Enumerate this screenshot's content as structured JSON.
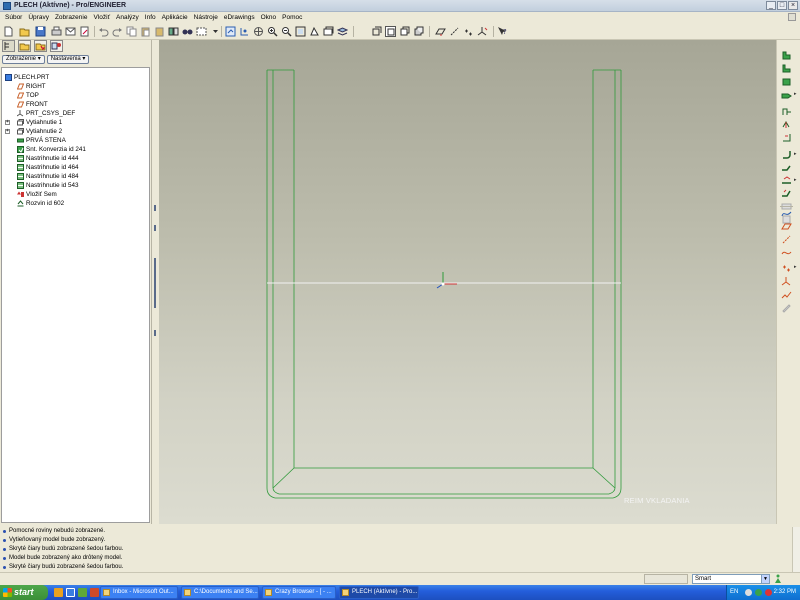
{
  "window": {
    "title": "PLECH (Aktívne) - Pro/ENGINEER",
    "controls": [
      "_",
      "□",
      "×"
    ]
  },
  "menu": [
    "Súbor",
    "Úpravy",
    "Zobrazenie",
    "Vložiť",
    "Analýzy",
    "Info",
    "Aplikácie",
    "Nástroje",
    "eDrawings",
    "Okno",
    "Pomoc"
  ],
  "panel": {
    "dropdowns": [
      "Zobrazenie",
      "Nastavenia"
    ]
  },
  "tree": [
    {
      "label": "PLECH.PRT",
      "icon": "part-icon",
      "indent": 0,
      "expander": ""
    },
    {
      "label": "RIGHT",
      "icon": "datum-plane-icon",
      "indent": 1,
      "expander": ""
    },
    {
      "label": "TOP",
      "icon": "datum-plane-icon",
      "indent": 1,
      "expander": ""
    },
    {
      "label": "FRONT",
      "icon": "datum-plane-icon",
      "indent": 1,
      "expander": ""
    },
    {
      "label": "PRT_CSYS_DEF",
      "icon": "csys-icon",
      "indent": 1,
      "expander": ""
    },
    {
      "label": "Vytiahnutie 1",
      "icon": "extrude-icon",
      "indent": 1,
      "expander": "+"
    },
    {
      "label": "Vytiahnutie 2",
      "icon": "extrude-icon",
      "indent": 1,
      "expander": "+"
    },
    {
      "label": "PRVÁ STENA",
      "icon": "wall-icon",
      "indent": 1,
      "expander": ""
    },
    {
      "label": "Snt. Konverzia id 241",
      "icon": "conversion-icon",
      "indent": 1,
      "expander": ""
    },
    {
      "label": "Nastrihnutie id 444",
      "icon": "rip-icon",
      "indent": 1,
      "expander": ""
    },
    {
      "label": "Nastrihnutie id 464",
      "icon": "rip-icon",
      "indent": 1,
      "expander": ""
    },
    {
      "label": "Nastrihnutie id 484",
      "icon": "rip-icon",
      "indent": 1,
      "expander": ""
    },
    {
      "label": "Nastrihnutie id 543",
      "icon": "rip-icon",
      "indent": 1,
      "expander": ""
    },
    {
      "label": "Vložiť Sem",
      "icon": "insert-here-icon",
      "indent": 1,
      "expander": ""
    },
    {
      "label": "Rozvin id 602",
      "icon": "unbend-icon",
      "indent": 1,
      "expander": ""
    }
  ],
  "viewport": {
    "mode_label": "REIM VKLADANIA",
    "background_top": "#a6a696",
    "background_bottom": "#dcdcd0",
    "edge_color": "#2f9a3a"
  },
  "messages": [
    "Pomocné roviny nebudú zobrazené.",
    "Vytieňovaný model bude zobrazený.",
    "Skryté čiary budú zobrazené šedou farbou.",
    "Model bude zobrazený ako drôtený model.",
    "Skryté čiary budú zobrazené šedou farbou."
  ],
  "status": {
    "filter_value": "Smart"
  },
  "taskbar": {
    "start_label": "start",
    "tasks": [
      {
        "label": "Inbox - Microsoft Out...",
        "active": false
      },
      {
        "label": "C:\\Documents and Se...",
        "active": false
      },
      {
        "label": "Crazy Browser - [ - ...",
        "active": false
      },
      {
        "label": "PLECH (Aktívne) - Pro...",
        "active": true
      }
    ],
    "language": "EN",
    "clock": "2:32 PM"
  }
}
